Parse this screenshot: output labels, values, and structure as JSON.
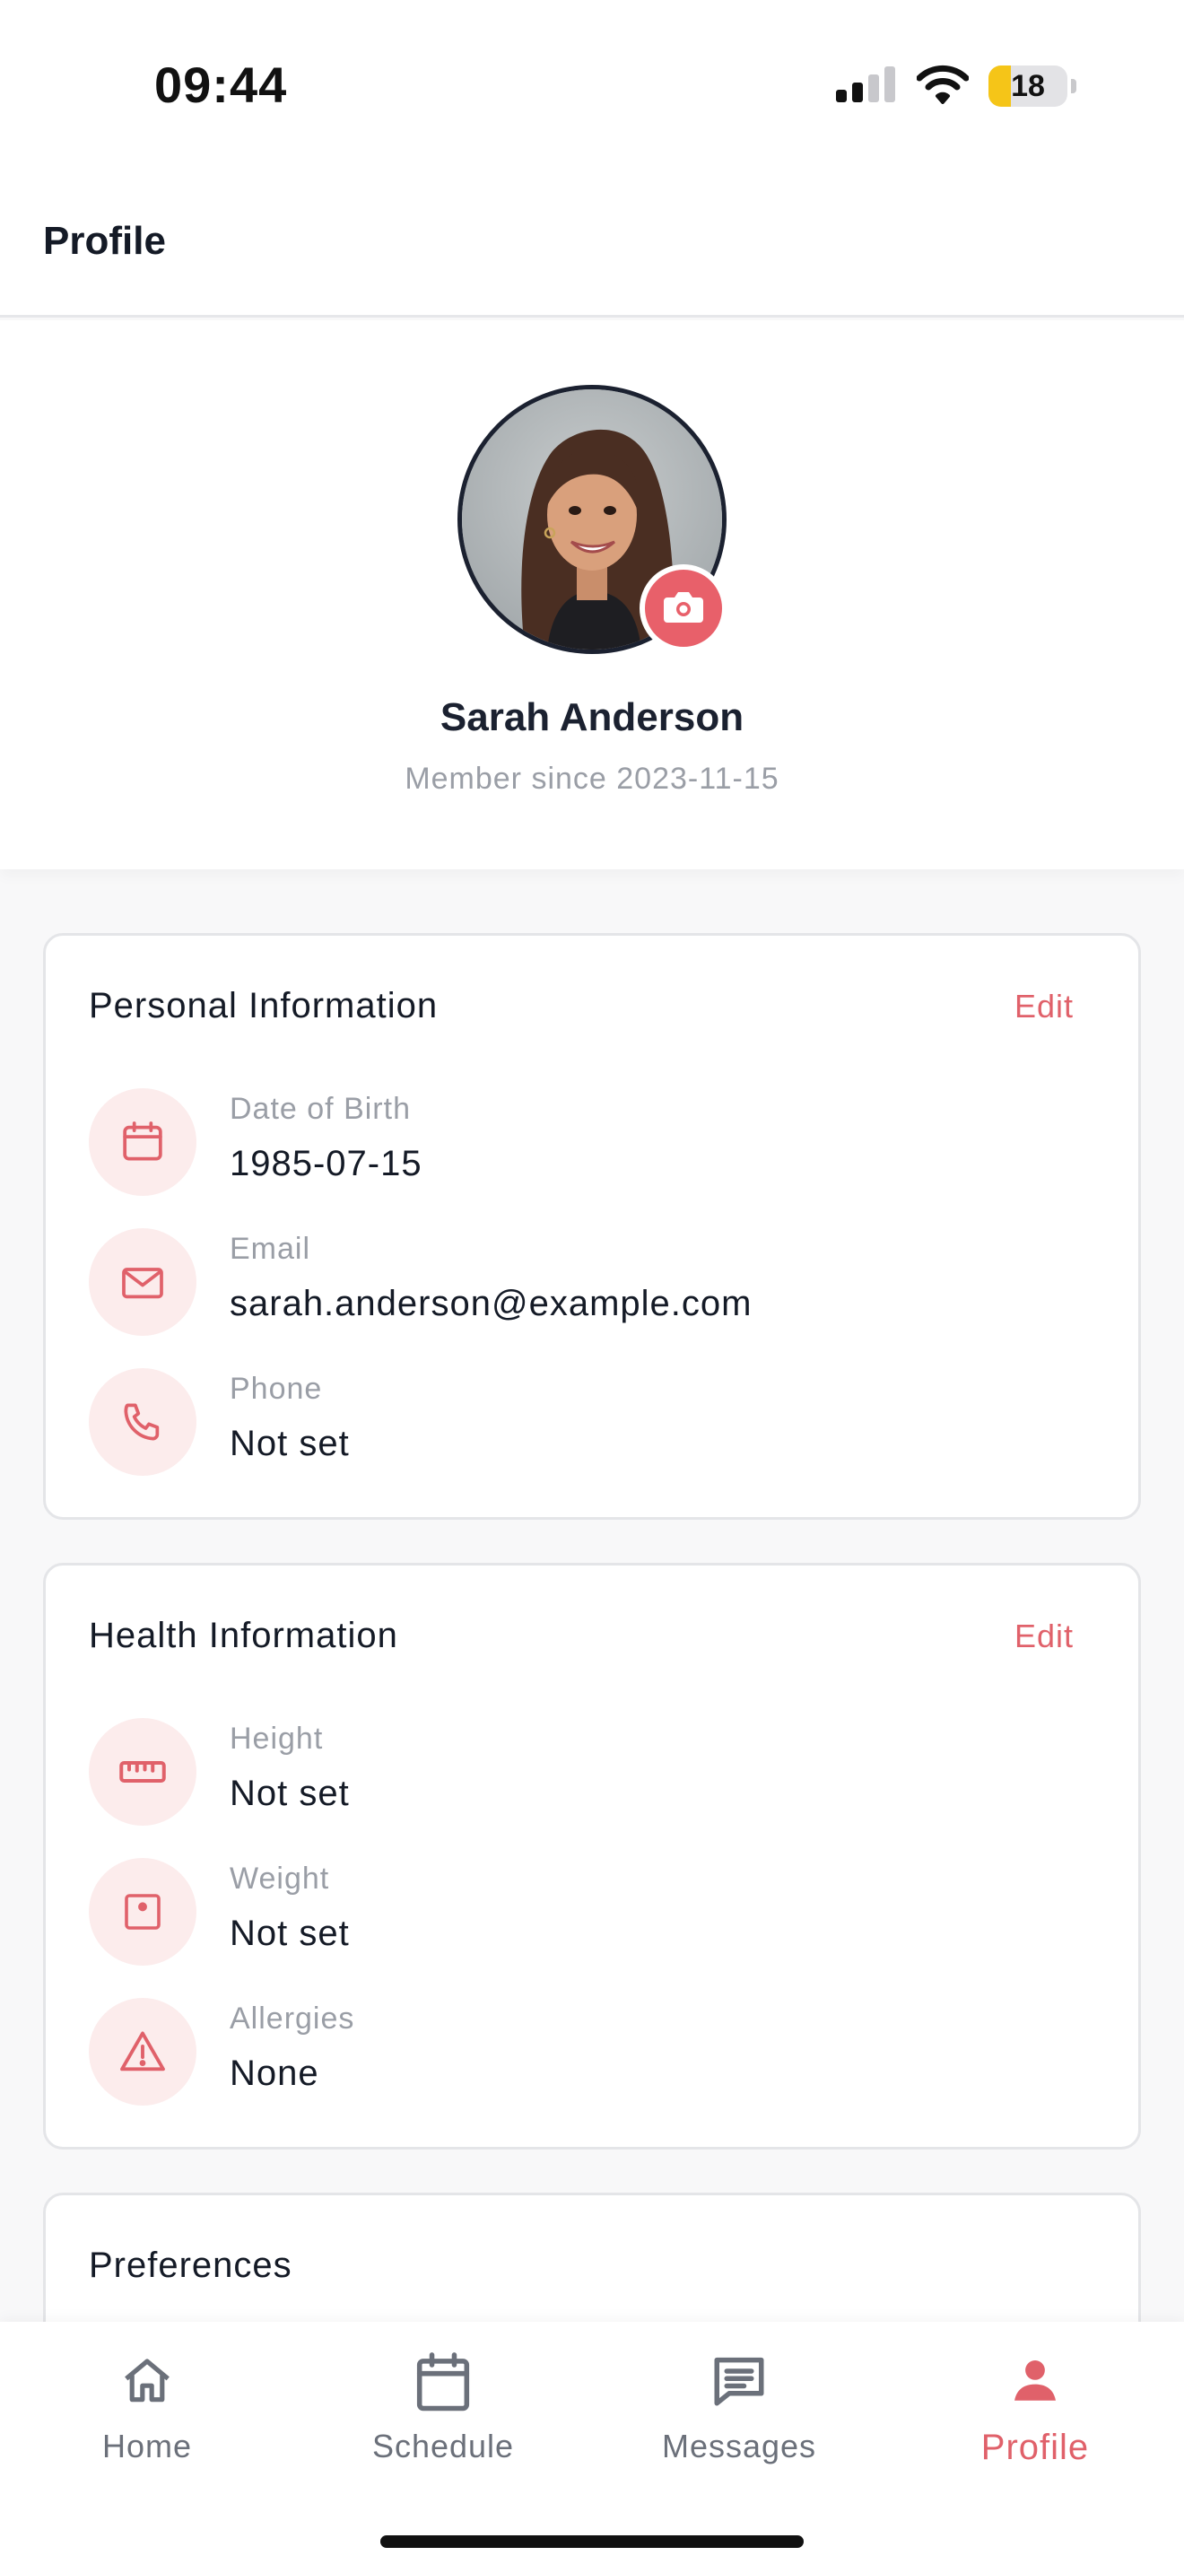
{
  "status": {
    "time": "09:44",
    "battery": "18",
    "battery_level": 0.18,
    "icons": [
      "cellular-signal-icon",
      "wifi-icon",
      "battery-icon"
    ]
  },
  "header": {
    "title": "Profile"
  },
  "profile": {
    "name": "Sarah Anderson",
    "member_since": "Member since 2023-11-15",
    "avatar_icon": "user-photo",
    "camera_icon": "camera-icon"
  },
  "personal": {
    "title": "Personal Information",
    "edit": "Edit",
    "rows": [
      {
        "label": "Date of Birth",
        "value": "1985-07-15",
        "icon": "calendar-icon"
      },
      {
        "label": "Email",
        "value": "sarah.anderson@example.com",
        "icon": "mail-icon"
      },
      {
        "label": "Phone",
        "value": "Not set",
        "icon": "phone-icon"
      }
    ]
  },
  "health": {
    "title": "Health Information",
    "edit": "Edit",
    "rows": [
      {
        "label": "Height",
        "value": "Not set",
        "icon": "ruler-icon"
      },
      {
        "label": "Weight",
        "value": "Not set",
        "icon": "scale-icon"
      },
      {
        "label": "Allergies",
        "value": "None",
        "icon": "warning-icon"
      }
    ]
  },
  "preferences": {
    "title": "Preferences"
  },
  "tabs": [
    {
      "label": "Home",
      "icon": "home-icon"
    },
    {
      "label": "Schedule",
      "icon": "calendar-icon"
    },
    {
      "label": "Messages",
      "icon": "message-icon"
    },
    {
      "label": "Profile",
      "icon": "person-icon",
      "active": true
    }
  ],
  "colors": {
    "accent": "#e0616a",
    "icon_bg": "#fcecec",
    "text_primary": "#141a26",
    "text_secondary": "#9a9ea6"
  }
}
